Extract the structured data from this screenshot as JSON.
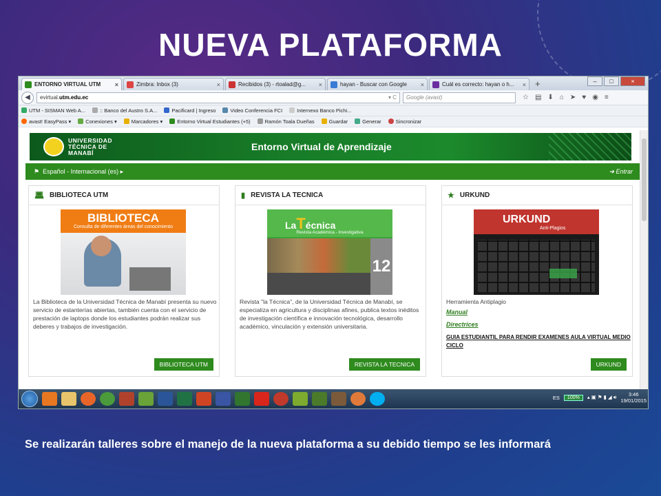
{
  "slide": {
    "title": "NUEVA PLATAFORMA",
    "caption": "Se realizarán talleres sobre el manejo de la nueva plataforma a su debido tiempo se les informará"
  },
  "browser": {
    "tabs": [
      {
        "label": "ENTORNO VIRTUAL UTM",
        "icon": "utm-favicon",
        "color": "#2e8b1e",
        "active": true
      },
      {
        "label": "Zimbra: Inbox (3)",
        "icon": "zimbra-favicon",
        "color": "#d44"
      },
      {
        "label": "Recibidos (3) - rtoalad@g...",
        "icon": "gmail-favicon",
        "color": "#c33"
      },
      {
        "label": "hayan - Buscar con Google",
        "icon": "google-favicon",
        "color": "#3a7bd5"
      },
      {
        "label": "Cuál es correcto: hayan o h...",
        "icon": "yahoo-favicon",
        "color": "#6a2ea0"
      }
    ],
    "new_tab": "+",
    "url_prefix": "evirtual.",
    "url_domain": "utm.edu.ec",
    "search_placeholder": "Google (avast)",
    "bookmarks_row1": [
      "UTM - SISMAN Web A...",
      ":: Banco del Austro S.A...",
      "Pacificard | Ingreso",
      "Video Conferencia FCI",
      "Internexo Banco Pichi..."
    ],
    "bookmarks_row2": [
      "avast! EasyPass ▾",
      "Conexiones ▾",
      "Marcadores ▾",
      "Entorno Virtual Estudiantes",
      "(+5)",
      "Ramón Toala Dueñas",
      "Guardar",
      "Generar",
      "Sincronizar"
    ]
  },
  "site": {
    "university": [
      "UNIVERSIDAD",
      "TÉCNICA DE",
      "MANABÍ"
    ],
    "banner_title": "Entorno Virtual de Aprendizaje",
    "language": "Español - Internacional (es) ▸",
    "enter": "Entrar",
    "cards": [
      {
        "title": "BIBLIOTECA UTM",
        "image_title": "BIBLIOTECA",
        "image_subtitle": "Consulta de diferentes áreas del conocimiento",
        "text": "La Biblioteca de la Universidad Técnica de Manabí presenta su nuevo servicio de estanterías abiertas, también cuenta con el servicio de prestación de laptops donde los estudiantes podrán realizar sus deberes y trabajos de investigación.",
        "button": "BIBLIOTECA UTM"
      },
      {
        "title": "REVISTA LA TECNICA",
        "image_title_pre": "La",
        "image_title_big": "T",
        "image_title_post": "écnica",
        "image_subtitle": "Revista Académica - Investigativa",
        "image_number": "12",
        "text": "Revista \"la Técnica\", de la Universidad Técnica de Manabí, se especializa en agricultura y disciplinas afines, publica textos inéditos de investigación científica e innovación tecnológica, desarrollo académico, vinculación y extensión universitaria.",
        "button": "REVISTA LA TECNICA"
      },
      {
        "title": "URKUND",
        "image_title": "URKUND",
        "image_subtitle": "Anti-Plagios",
        "text": "Herramienta Antiplagio",
        "links": [
          "Manual",
          "Directrices"
        ],
        "guide": "GUIA ESTUDIANTIL PARA RENDIR EXAMENES AULA VIRTUAL MEDIO CICLO",
        "button": "URKUND"
      }
    ]
  },
  "taskbar": {
    "language": "ES",
    "battery": "100%",
    "time": "3:46",
    "date": "19/01/2015"
  }
}
